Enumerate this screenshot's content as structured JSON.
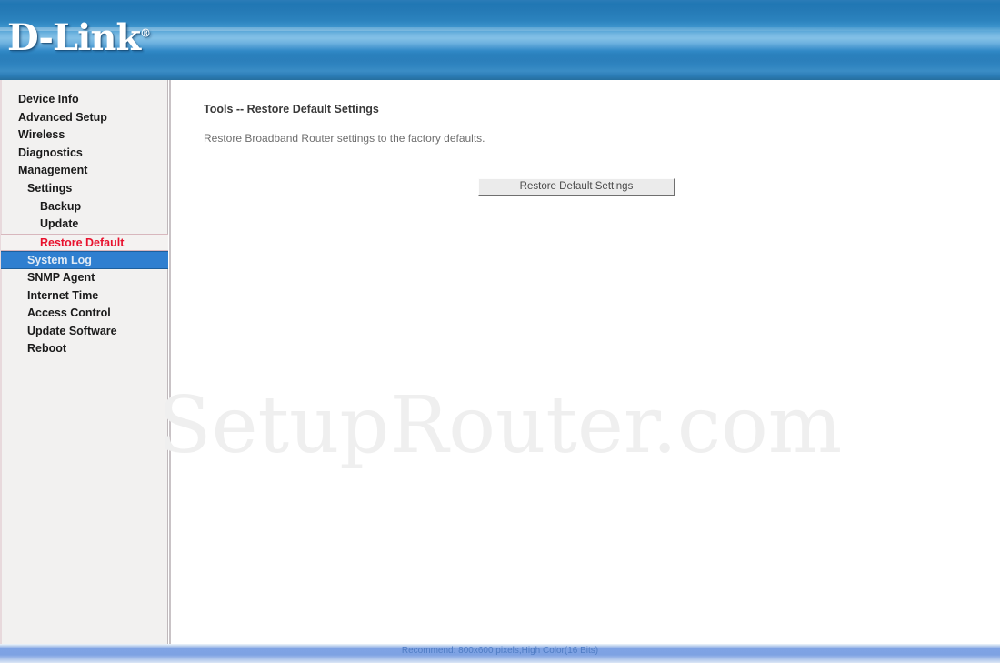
{
  "header": {
    "logo_text": "D-Link",
    "logo_tm": "®"
  },
  "sidebar": {
    "items": [
      {
        "label": "Device Info",
        "level": 0,
        "state": "normal"
      },
      {
        "label": "Advanced Setup",
        "level": 0,
        "state": "normal"
      },
      {
        "label": "Wireless",
        "level": 0,
        "state": "normal"
      },
      {
        "label": "Diagnostics",
        "level": 0,
        "state": "normal"
      },
      {
        "label": "Management",
        "level": 0,
        "state": "normal"
      },
      {
        "label": "Settings",
        "level": 1,
        "state": "normal"
      },
      {
        "label": "Backup",
        "level": 2,
        "state": "normal"
      },
      {
        "label": "Update",
        "level": 2,
        "state": "normal"
      },
      {
        "label": "Restore Default",
        "level": 2,
        "state": "active-red"
      },
      {
        "label": "System Log",
        "level": 1,
        "state": "active-blue"
      },
      {
        "label": "SNMP Agent",
        "level": 1,
        "state": "normal"
      },
      {
        "label": "Internet Time",
        "level": 1,
        "state": "normal"
      },
      {
        "label": "Access Control",
        "level": 1,
        "state": "normal"
      },
      {
        "label": "Update Software",
        "level": 1,
        "state": "normal"
      },
      {
        "label": "Reboot",
        "level": 1,
        "state": "normal"
      }
    ]
  },
  "main": {
    "title": "Tools -- Restore Default Settings",
    "description": "Restore Broadband Router settings to the factory defaults.",
    "restore_button_label": "Restore Default Settings"
  },
  "watermark": {
    "text": "SetupRouter.com"
  },
  "footer": {
    "text": "Recommend: 800x600 pixels,High Color(16 Bits)"
  },
  "colors": {
    "header_blue": "#2b7cb8",
    "selection_blue": "#2f7fd0",
    "active_red": "#e8112d",
    "sidebar_bg": "#f2f1f0",
    "footer_blue": "#7ea2e3"
  }
}
